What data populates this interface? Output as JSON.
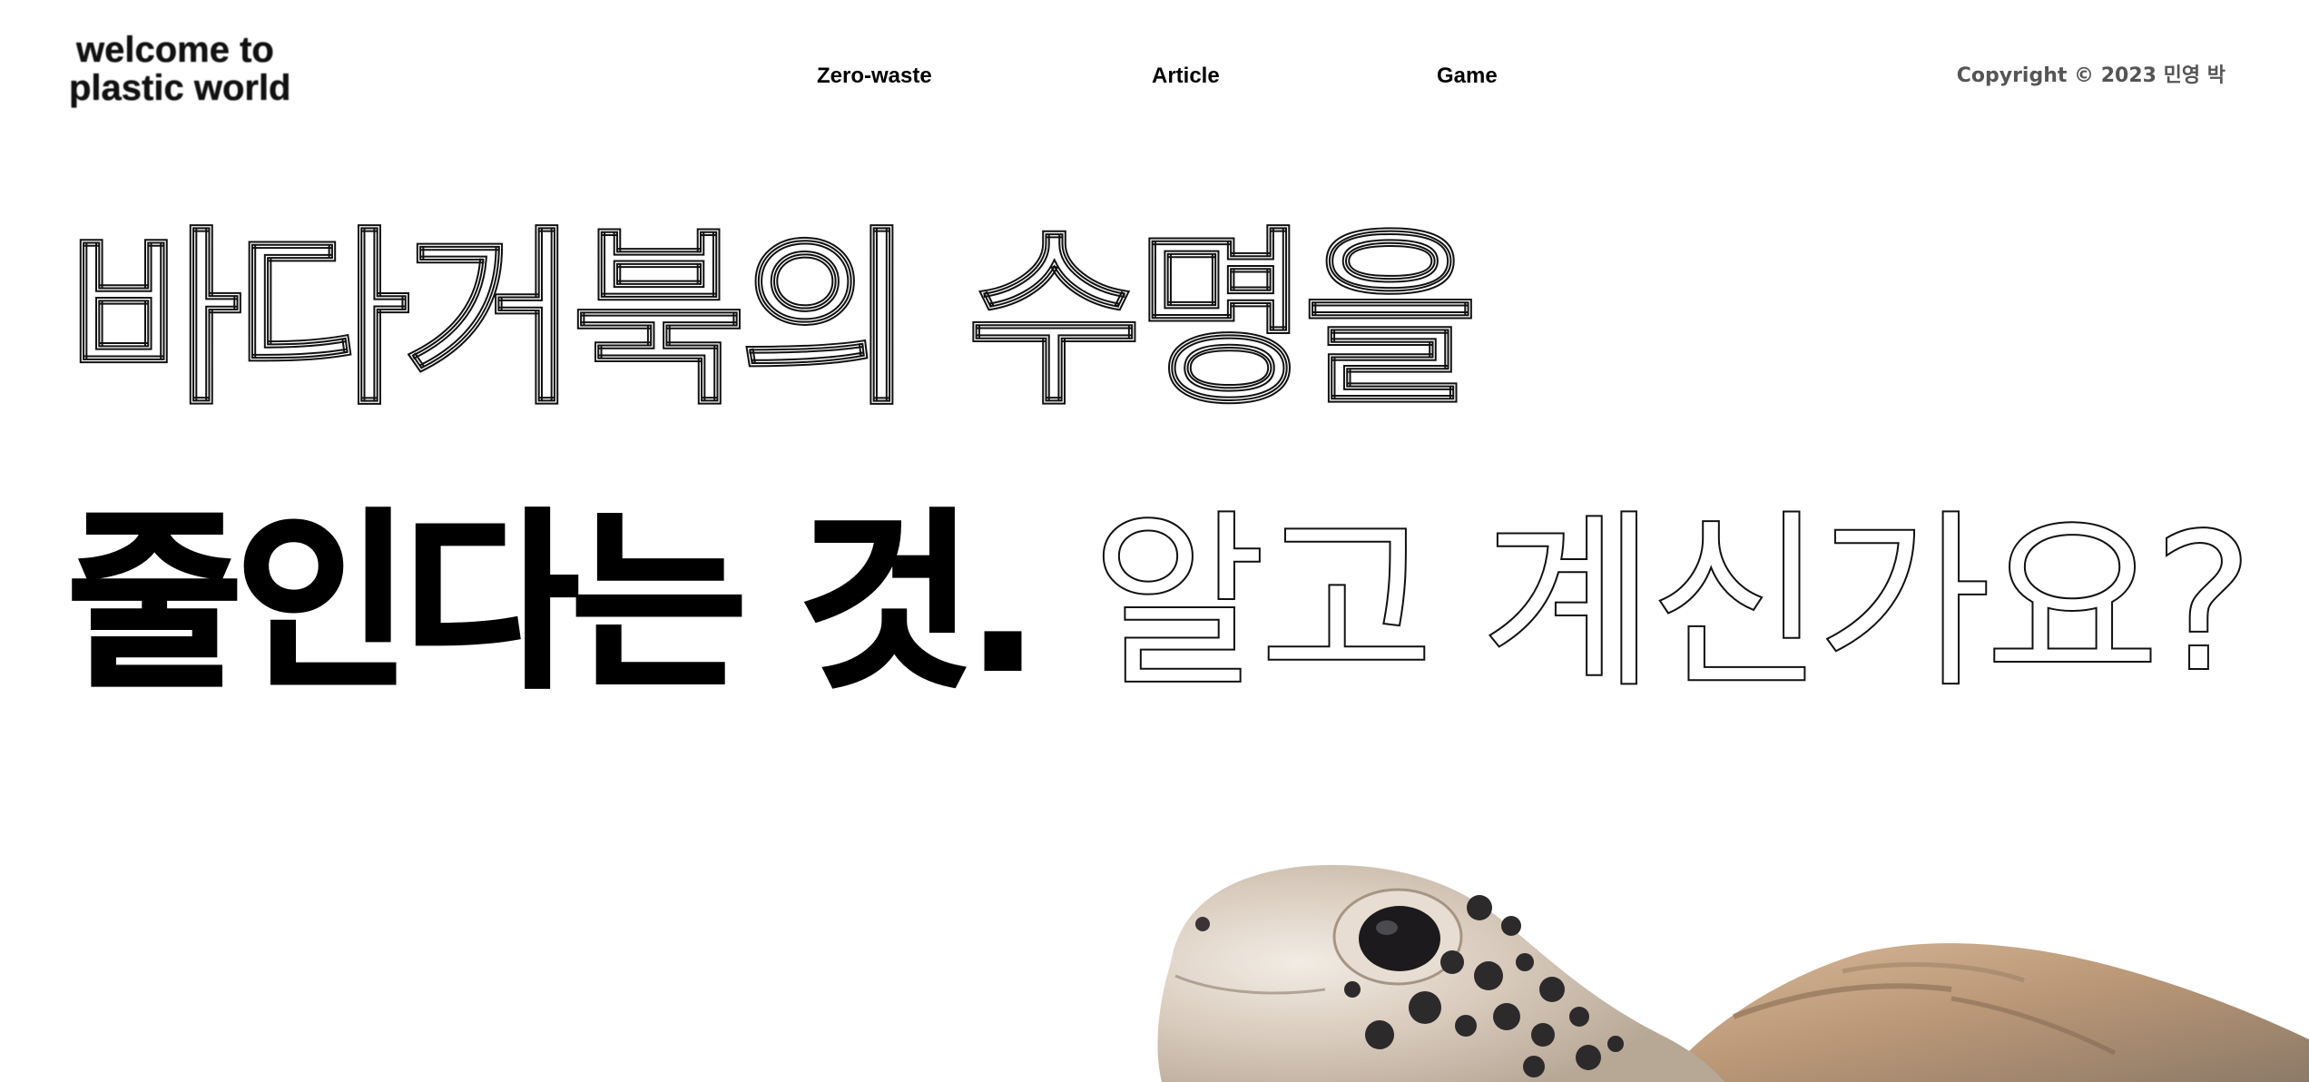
{
  "header": {
    "logo_line1": "welcome to",
    "logo_line2": "plastic world",
    "nav": {
      "zero_waste": "Zero-waste",
      "article": "Article",
      "game": "Game"
    },
    "copyright": "Copyright © 2023 민영 박"
  },
  "hero": {
    "line1": "바다거북의 수명을",
    "line2_solid": "줄인다는 것.",
    "line2_outline": "알고 계신가요?"
  },
  "image": {
    "subject": "sea-turtle-icon"
  },
  "colors": {
    "text": "#000000",
    "copyright": "#555555",
    "background": "#ffffff"
  }
}
